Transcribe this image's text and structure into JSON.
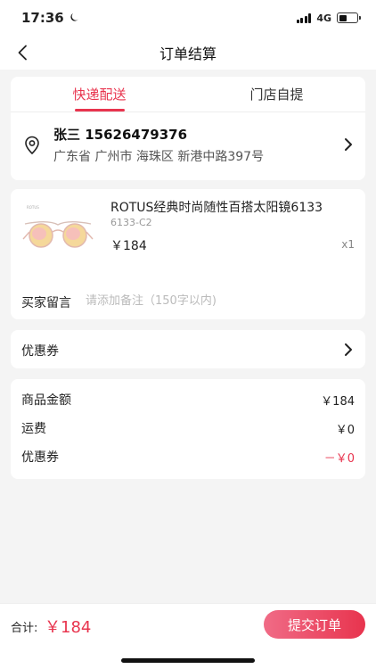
{
  "status_bar": {
    "time": "17:36",
    "network": "4G",
    "battery_level": 0.45
  },
  "nav": {
    "title": "订单结算"
  },
  "delivery": {
    "tabs": [
      {
        "label": "快递配送",
        "active": true
      },
      {
        "label": "门店自提",
        "active": false
      }
    ],
    "address": {
      "name_phone": "张三 15626479376",
      "detail": "广东省 广州市 海珠区 新港中路397号"
    }
  },
  "product": {
    "name": "ROTUS经典时尚随性百搭太阳镜6133",
    "sku": "6133-C2",
    "price": "￥184",
    "quantity": "x1",
    "note_label": "买家留言",
    "note_placeholder": "请添加备注（150字以内)"
  },
  "coupon": {
    "label": "优惠券"
  },
  "summary": {
    "rows": [
      {
        "label": "商品金额",
        "value": "￥184"
      },
      {
        "label": "运费",
        "value": "￥0"
      },
      {
        "label": "优惠券",
        "value": "－￥0"
      }
    ]
  },
  "footer": {
    "total_label": "合计:",
    "total_value": "￥184",
    "submit_label": "提交订单"
  },
  "colors": {
    "accent": "#e8344e"
  }
}
